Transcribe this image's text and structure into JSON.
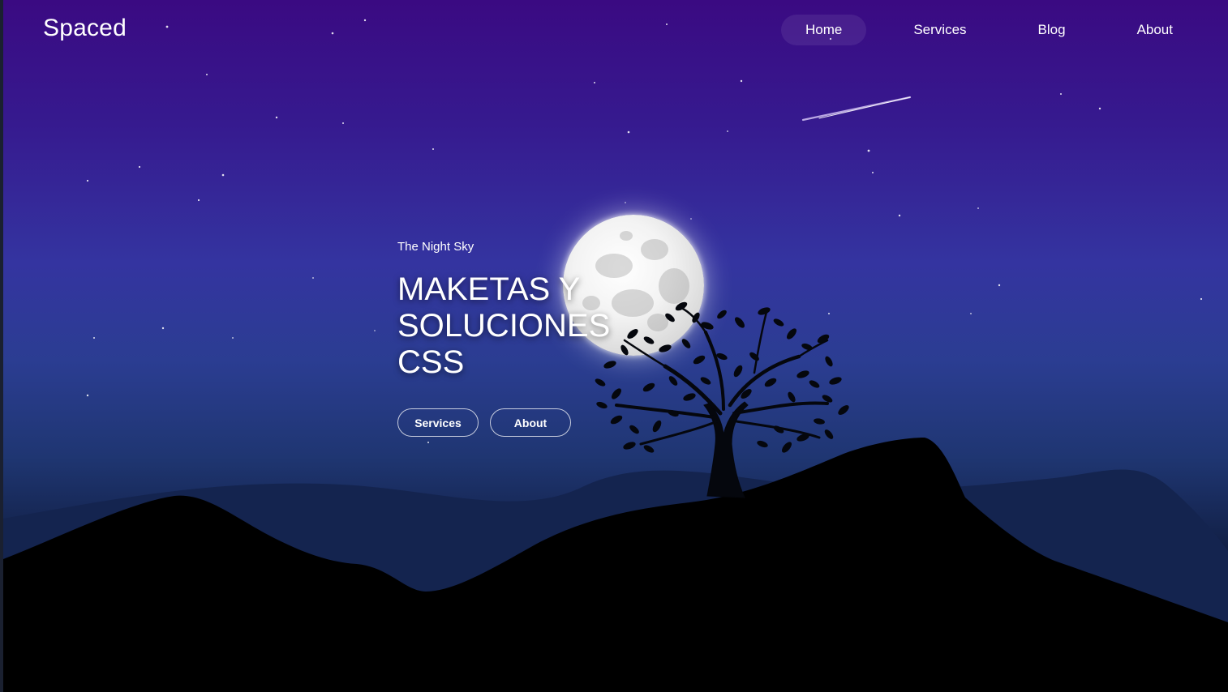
{
  "nav": {
    "logo": "Spaced",
    "links": [
      {
        "label": "Home",
        "active": true
      },
      {
        "label": "Services",
        "active": false
      },
      {
        "label": "Blog",
        "active": false
      },
      {
        "label": "About",
        "active": false
      }
    ]
  },
  "hero": {
    "eyebrow": "The Night Sky",
    "title": "MAKETAS Y SOLUCIONES CSS",
    "buttons": {
      "services_label": "Services",
      "about_label": "About"
    }
  },
  "scene": {
    "icons": [
      "moon-icon",
      "tree-icon",
      "shooting-star-icon",
      "mountains-icon"
    ],
    "colors": {
      "sky_top": "#3a0a82",
      "sky_mid": "#3434a0",
      "horizon": "#13224a",
      "ground": "#000000",
      "moon": "#f3f3f3"
    }
  }
}
